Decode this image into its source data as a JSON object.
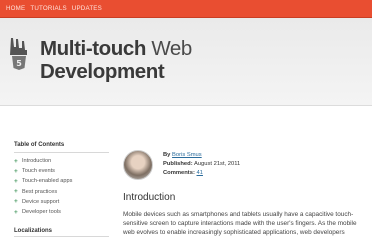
{
  "topnav": {
    "items": [
      "HOME",
      "TUTORIALS",
      "UPDATES"
    ]
  },
  "hero": {
    "title_part1_bold": "Multi-touch",
    "title_part1_light": "Web",
    "title_part2": "Development",
    "logo_icon": "rock-hand-html5-icon"
  },
  "sidebar": {
    "toc_heading": "Table of Contents",
    "toc_items": [
      "Introduction",
      "Touch events",
      "Touch-enabled apps",
      "Best practices",
      "Device support",
      "Developer tools"
    ],
    "localizations_heading": "Localizations"
  },
  "article": {
    "by_label": "By",
    "author": "Boris Smus",
    "published_label": "Published:",
    "published_date": "August 21st, 2011",
    "comments_label": "Comments:",
    "comments_count": "41",
    "section_title": "Introduction",
    "paragraph": "Mobile devices such as smartphones and tablets usually have a capacitive touch-sensitive screen to capture interactions made with the user's fingers. As the mobile web evolves to enable increasingly sophisticated applications, web developers"
  },
  "colors": {
    "topbar": "#e94e31",
    "accent_green": "#4a9a64",
    "link": "#2b6c9c"
  }
}
